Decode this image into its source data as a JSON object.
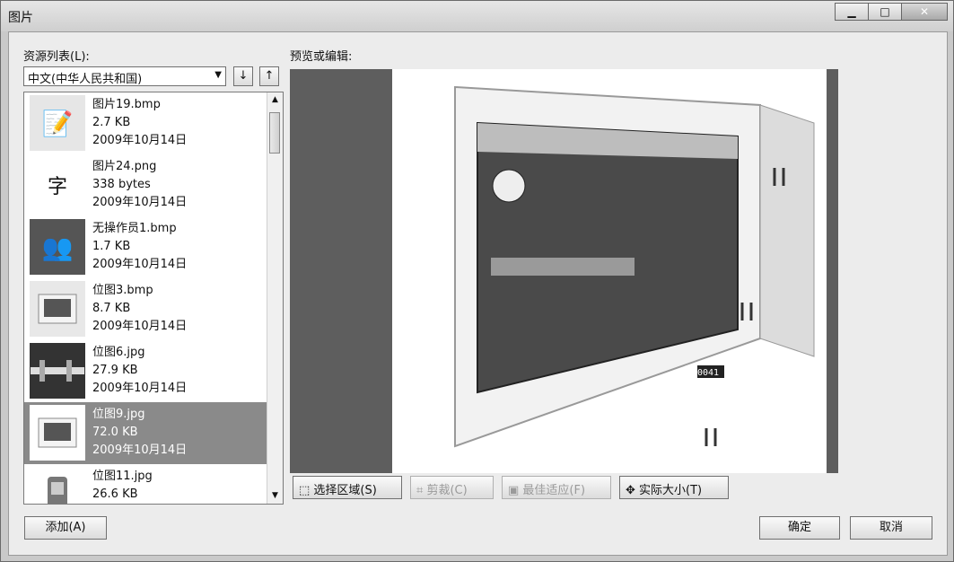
{
  "window": {
    "title": "图片"
  },
  "left": {
    "label": "资源列表(L):",
    "language": "中文(中华人民共和国)",
    "down_arrow": "↓",
    "up_arrow": "↑"
  },
  "items": [
    {
      "name": "图片19.bmp",
      "size": "2.7 KB",
      "date": "2009年10月14日",
      "icon": "document-edit-icon"
    },
    {
      "name": "图片24.png",
      "size": "338 bytes",
      "date": "2009年10月14日",
      "icon": "chinese-characters-icon"
    },
    {
      "name": "无操作员1.bmp",
      "size": "1.7 KB",
      "date": "2009年10月14日",
      "icon": "users-icon"
    },
    {
      "name": "位图3.bmp",
      "size": "8.7 KB",
      "date": "2009年10月14日",
      "icon": "hmi-thumbnail"
    },
    {
      "name": "位图6.jpg",
      "size": "27.9 KB",
      "date": "2009年10月14日",
      "icon": "pipeline-thumbnail"
    },
    {
      "name": "位图9.jpg",
      "size": "72.0 KB",
      "date": "2009年10月14日",
      "icon": "hmi-thumbnail",
      "selected": true
    },
    {
      "name": "位图11.jpg",
      "size": "26.6 KB",
      "date": "",
      "icon": "device-thumbnail"
    }
  ],
  "preview": {
    "label": "预览或编辑:"
  },
  "toolbar": {
    "select_region": "选择区域(S)",
    "crop": "剪裁(C)",
    "best_fit": "最佳适应(F)",
    "actual_size": "实际大小(T)"
  },
  "buttons": {
    "add": "添加(A)",
    "ok": "确定",
    "cancel": "取消"
  }
}
